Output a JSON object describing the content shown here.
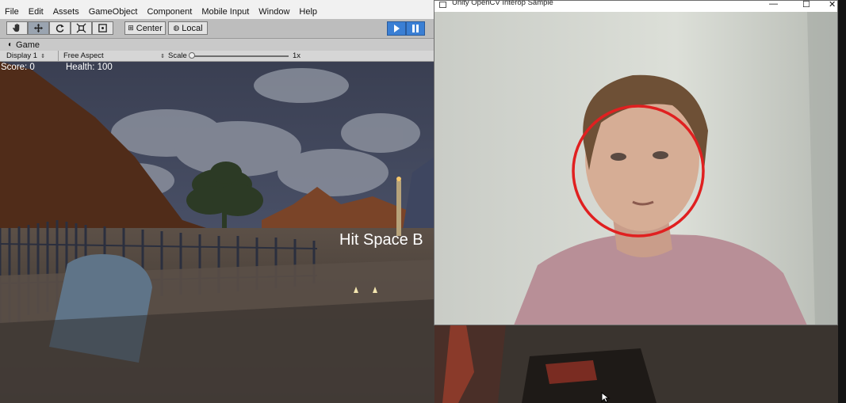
{
  "menubar": {
    "items": [
      "File",
      "Edit",
      "Assets",
      "GameObject",
      "Component",
      "Mobile Input",
      "Window",
      "Help"
    ]
  },
  "toolbar": {
    "tools": [
      "hand-tool-icon",
      "move-tool-icon",
      "rotate-tool-icon",
      "scale-tool-icon",
      "rect-tool-icon"
    ],
    "pivot_label": "Center",
    "space_label": "Local",
    "play_state": "playing",
    "accent": "#3b7fd4"
  },
  "game_tab": {
    "label": "Game",
    "display": "Display 1",
    "aspect": "Free Aspect",
    "scale_label": "Scale",
    "scale_value": "1x"
  },
  "hud": {
    "score": "Score: 0",
    "health": "Health: 100",
    "message": "Hit Space B"
  },
  "webcam_window": {
    "title": "Unity OpenCV Interop Sample",
    "minimize": "—",
    "maximize": "☐",
    "close": "✕",
    "face_marker_color": "#e02020"
  }
}
